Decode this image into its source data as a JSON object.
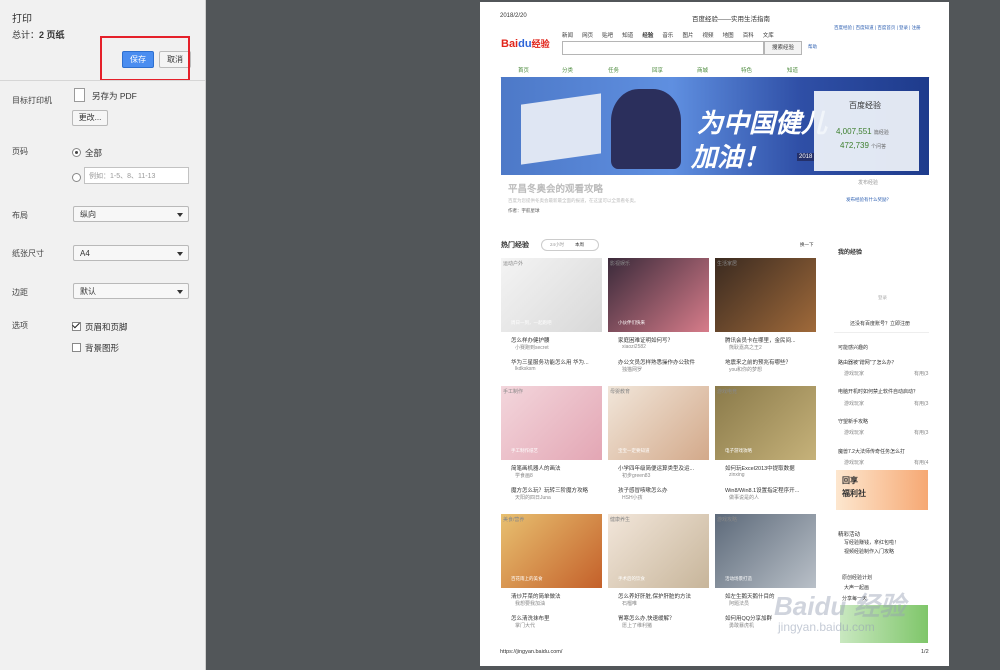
{
  "sidebar": {
    "title": "打印",
    "total_prefix": "总计：",
    "total_value": "2 页纸",
    "save_label": "保存",
    "cancel_label": "取消",
    "destination_label": "目标打印机",
    "destination_value": "另存为 PDF",
    "change_label": "更改...",
    "pages_label": "页码",
    "pages_all": "全部",
    "pages_placeholder": "例如：1-5、8、11-13",
    "layout_label": "布局",
    "layout_value": "纵向",
    "paper_label": "纸张尺寸",
    "paper_value": "A4",
    "margin_label": "边距",
    "margin_value": "默认",
    "options_label": "选项",
    "opt_headers": "页眉和页脚",
    "opt_bg": "背景图形"
  },
  "preview": {
    "date": "2018/2/20",
    "doc_title": "百度经验——实用生活指南",
    "top_links": "百度经验 | 百度知道 | 百度首页 | 登录 | 注册",
    "logo": "Bai",
    "logo2": "du",
    "logo3": "经验",
    "nav": [
      "新闻",
      "网页",
      "贴吧",
      "知道",
      "经验",
      "音乐",
      "图片",
      "视频",
      "地图",
      "百科",
      "文库"
    ],
    "search_btn": "搜索经验",
    "help": "帮助",
    "subnav": [
      "首页",
      "分类",
      "任务",
      "回享",
      "商城",
      "特色",
      "知道"
    ],
    "banner_text1": "为中国健儿",
    "banner_text2": "加油！",
    "banner_badge": "2018",
    "stats_title": "百度经验",
    "stats_num1": "4,007,551",
    "stats_unit1": "篇经验",
    "stats_num2": "472,739",
    "stats_unit2": "个问答",
    "publish": "发布经验",
    "publish_hint": "发布经验有什么奖励？",
    "headline": "平昌冬奥会的观看攻略",
    "headline_sub": "百度为您提供冬奥会最新最全面的报道，在这里可以全景看冬奥。",
    "author": "作者：宇航星球",
    "hot_title": "热门经验",
    "tab_24h": "24小时",
    "tab_week": "本周",
    "change_batch": "换一下",
    "my_exp": "我的经验",
    "login_hint": "登录",
    "not_logged": "还没有百度账号？立即注册",
    "maybe": "可能感兴趣的",
    "side_items": [
      {
        "t": "路由器被\"蹭网\"了怎么办？",
        "a": "游戏玩家",
        "n": "有用(3"
      },
      {
        "t": "电脑开机时如何禁止软件自动启动？",
        "a": "游戏玩家",
        "n": "有用(3"
      },
      {
        "t": "守望新手攻略",
        "a": "游戏玩家",
        "n": "有用(3"
      },
      {
        "t": "魔兽7.2大法师传奇任务怎么打",
        "a": "游戏玩家",
        "n": "有用(4"
      }
    ],
    "promo_a": "回享",
    "promo_b": "福利社",
    "activity": "精彩活动",
    "activity_1": "写经验赚钱，拿红包啦！",
    "activity_2": "视频经验制作入门攻略",
    "activity_3": "原创经验计划",
    "activity_4": "大声一起画",
    "activity_5": "分享每一天",
    "cards": [
      {
        "tag": "运动户外",
        "caption": "周日一到，一起跑吧",
        "title": "怎么样办健护腰",
        "author": "小赛跑到secret",
        "title2": "华为三星服务功能怎么用 华为...",
        "author2": "lkdksksm"
      },
      {
        "tag": "影视娱乐",
        "caption": "小伙伴们快来",
        "title": "家庭困难证明如何写？",
        "author": "xiaozi2582",
        "title2": "办公文员怎样熟悉操作办公软件",
        "author2": "独猫网罗"
      },
      {
        "tag": "生活家居",
        "caption": "",
        "title": "腾讯会员卡在哪里，金民间...",
        "author": "熊耿嘉高之王2",
        "title2": "地震来之前的预兆有哪些？",
        "author2": "you和你的梦想"
      },
      {
        "tag": "手工制作",
        "caption": "手工制作纸艺",
        "title": "简笔画机器人的画法",
        "author": "学食画8",
        "title2": "魔方怎么玩？玩转三阶魔方攻略",
        "author2": "天阳的四日Juna"
      },
      {
        "tag": "母婴教育",
        "caption": "宝宝一定要知道",
        "title": "小学四年级简便运算类型及运...",
        "author": "初步green83",
        "title2": "孩子感冒咳嗽怎么办",
        "author2": "HSH小孩"
      },
      {
        "tag": "游戏电竞",
        "caption": "电子游戏攻略",
        "title": "如何玩Excel2013中提取数据",
        "author": "zinxing",
        "title2": "Win8/Win8.1设置指定程序开...",
        "author2": "做事说是的人"
      },
      {
        "tag": "美食/营养",
        "caption": "百花雨上的美食",
        "title": "清炒芹菜的简单做法",
        "author": "我想要我加油",
        "title2": "怎么清洗抹布里",
        "author2": "掌门大代"
      },
      {
        "tag": "健康养生",
        "caption": "手术后的饮食",
        "title": "怎么养好肝脏,保护肝脏的方法",
        "author": "石榴唯",
        "title2": "胃寒怎么办,快速缓解？",
        "author2": "愿上了维利猪"
      },
      {
        "tag": "游戏攻略",
        "caption": "活动场景打造",
        "title": "如左生鹅天鹅什目的",
        "author": "阿题法员",
        "title2": "如何用QQ分享加群",
        "author2": "勇敢暴虎机"
      }
    ],
    "footer_url": "https://jingyan.baidu.com/",
    "page_num": "1/2",
    "watermark": "Baidu 经验",
    "watermark2": "jingyan.baidu.com"
  },
  "colors": {
    "sidebar_bg": "#f1f1f1",
    "accent": "#4a8df0",
    "highlight": "#e5202a",
    "canvas": "#525659"
  }
}
